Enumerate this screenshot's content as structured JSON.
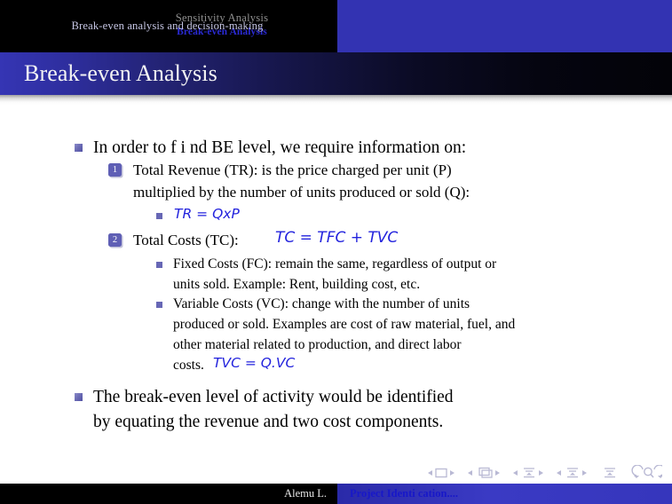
{
  "header": {
    "section_nav": "Sensitivity Analysis",
    "subsection_nav": "Break-even  Analysis",
    "current_title": "Break-even  analysis  and  decision-making"
  },
  "title_bar": {
    "title": "Break-even Analysis"
  },
  "content": {
    "bullet1": {
      "text": "In order to  f i nd BE level, we require information on:",
      "items": [
        {
          "number": "1",
          "line1": "Total Revenue (TR): is  the price charged per unit (P)",
          "line2": "multiplied by the number of units produced or sold (Q):",
          "formula": "TR  = QxP"
        },
        {
          "number": "2",
          "label": "Total Costs (TC):",
          "formula": "TC  = TFC  + TVC",
          "subitems": [
            {
              "line1": "Fixed Costs (FC): remain the same, regardless of output or",
              "line2": "units sold.  Example:  Rent, building cost, etc."
            },
            {
              "line1": "Variable Costs (VC): change with the number of units",
              "line2": "produced or sold.  Examples are cost of raw material, fuel, and",
              "line3": "other material related to production, and direct labor",
              "line4_prefix": "costs.",
              "line4_formula": "TVC  = Q.VC"
            }
          ]
        }
      ]
    },
    "bullet2": {
      "line1": "The break-even level of activity would be identified",
      "line2": "by equating the revenue and two cost components."
    }
  },
  "footer": {
    "author": "Alemu L.",
    "doc_title": "Project Identi cation...."
  },
  "nav_symbols": {
    "slide_icon": "slide-navigation-icon",
    "frame_icon": "frame-navigation-icon",
    "subsection_icon": "subsection-navigation-icon",
    "section_icon": "section-navigation-icon",
    "doc_icon": "document-navigation-icon",
    "back_icon": "go-back-icon",
    "search_icon": "search-icon",
    "forward_icon": "go-forward-icon"
  },
  "colors": {
    "accent_blue": "#3333b2",
    "formula_blue": "#2222dd",
    "bullet_purple": "#5f5fb5",
    "title_text": "#f4f4f4"
  }
}
